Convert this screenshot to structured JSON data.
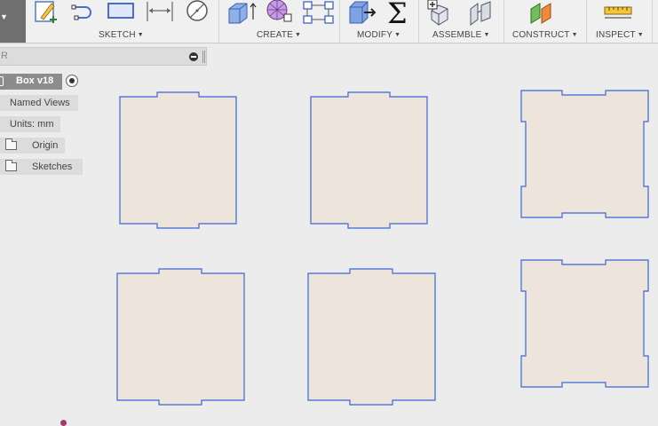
{
  "toolbar": {
    "groups": [
      {
        "label": "SKETCH"
      },
      {
        "label": "CREATE"
      },
      {
        "label": "MODIFY"
      },
      {
        "label": "ASSEMBLE"
      },
      {
        "label": "CONSTRUCT"
      },
      {
        "label": "INSPECT"
      }
    ],
    "icons": {
      "sketch": [
        "create-sketch-icon",
        "spline-icon",
        "rectangle-icon",
        "dimension-icon",
        "circle-icon"
      ],
      "create": [
        "extrude-icon",
        "form-icon",
        "pattern-icon"
      ],
      "modify": [
        "press-pull-icon",
        "parameters-icon"
      ],
      "assemble": [
        "new-component-icon",
        "joint-icon"
      ],
      "construct": [
        "offset-plane-icon"
      ],
      "inspect": [
        "measure-icon"
      ]
    },
    "accent_color": "#3b66d6"
  },
  "browser": {
    "search_placeholder": "R",
    "root": {
      "label": "Box v18"
    },
    "items": [
      {
        "label": "Named Views"
      },
      {
        "label": "Units: mm"
      },
      {
        "label": "Origin"
      },
      {
        "label": "Sketches"
      }
    ]
  },
  "canvas": {
    "background": "#ececec",
    "piece_fill": "#ede5dc",
    "piece_outline": "#3b66d6"
  }
}
